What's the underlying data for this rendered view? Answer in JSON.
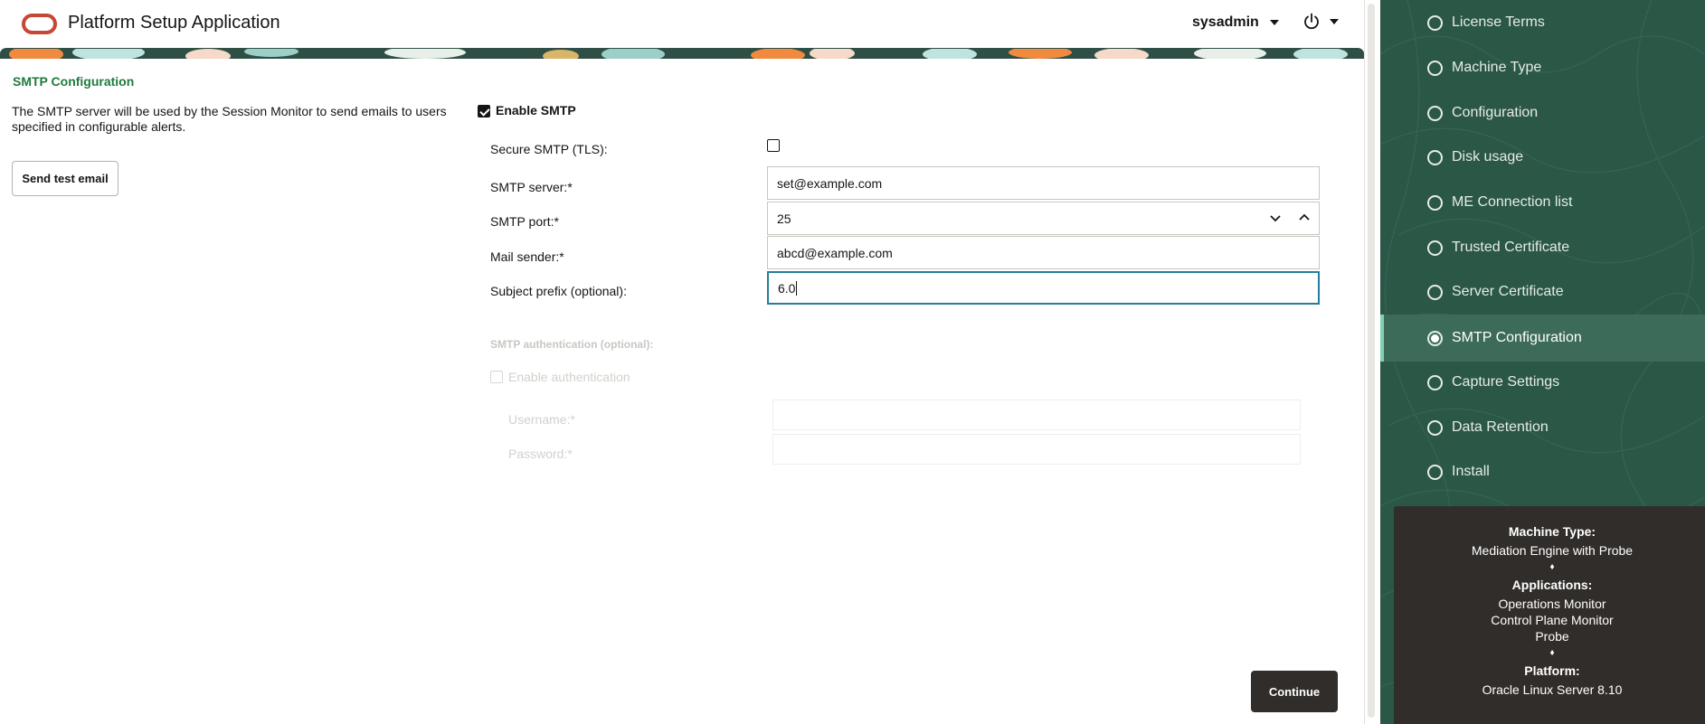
{
  "header": {
    "app_title": "Platform Setup Application",
    "user": "sysadmin"
  },
  "page": {
    "section_title": "SMTP Configuration",
    "description": "The SMTP server will be used by the Session Monitor to send emails to users specified in configurable alerts.",
    "send_test_label": "Send test email",
    "continue_label": "Continue"
  },
  "form": {
    "enable_smtp_label": "Enable SMTP",
    "enable_smtp_checked": true,
    "secure_label": "Secure SMTP (TLS):",
    "secure_checked": false,
    "server_label": "SMTP server:*",
    "server_value": "set@example.com",
    "port_label": "SMTP port:*",
    "port_value": "25",
    "sender_label": "Mail sender:*",
    "sender_value": "abcd@example.com",
    "prefix_label": "Subject prefix (optional):",
    "prefix_value": "6.0",
    "auth_header": "SMTP authentication (optional):",
    "enable_auth_label": "Enable authentication",
    "username_label": "Username:*",
    "password_label": "Password:*"
  },
  "nav": {
    "items": [
      {
        "label": "License Terms",
        "active": false
      },
      {
        "label": "Machine Type",
        "active": false
      },
      {
        "label": "Configuration",
        "active": false
      },
      {
        "label": "Disk usage",
        "active": false
      },
      {
        "label": "ME Connection list",
        "active": false
      },
      {
        "label": "Trusted Certificate",
        "active": false
      },
      {
        "label": "Server Certificate",
        "active": false
      },
      {
        "label": "SMTP Configuration",
        "active": true
      },
      {
        "label": "Capture Settings",
        "active": false
      },
      {
        "label": "Data Retention",
        "active": false
      },
      {
        "label": "Install",
        "active": false
      }
    ]
  },
  "summary": {
    "machine_type_header": "Machine Type:",
    "machine_type_value": "Mediation Engine with Probe",
    "separator": "♦",
    "applications_header": "Applications:",
    "applications": [
      "Operations Monitor",
      "Control Plane Monitor",
      "Probe"
    ],
    "platform_header": "Platform:",
    "platform_value": "Oracle Linux Server 8.10"
  },
  "colors": {
    "accent_green": "#1f7a3d",
    "nav_bg": "#2b5747",
    "nav_active": "#3d6b59",
    "focus_border": "#227e9e",
    "dark_button": "#312d2a",
    "logo_red": "#c74634"
  },
  "icons": {
    "logo": "oracle-logo-icon",
    "user_menu": "caret-down-icon",
    "power": "power-icon",
    "dropdown_open": "chevron-down-icon",
    "dropdown_close": "chevron-up-icon",
    "nav_state": "radio-icon"
  }
}
